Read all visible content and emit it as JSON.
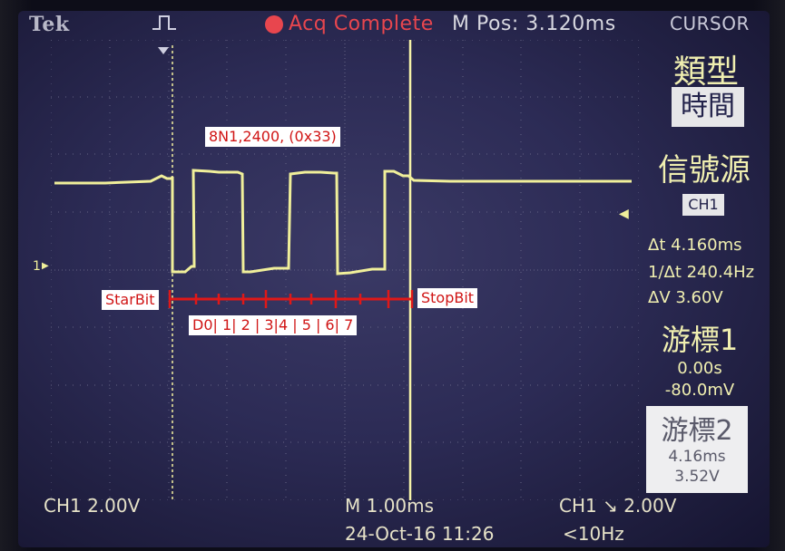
{
  "top": {
    "brand": "Tek",
    "status": "Acq Complete",
    "m_pos": "M Pos: 3.120ms",
    "menu_title": "CURSOR"
  },
  "panel": {
    "type_label": "類型",
    "type_value": "時間",
    "source_label": "信號源",
    "source_value": "CH1",
    "delta_t": "Δt 4.160ms",
    "inv_delta_t": "1/Δt 240.4Hz",
    "delta_v": "ΔV 3.60V",
    "cursor1_label": "游標1",
    "cursor1_time": "0.00s",
    "cursor1_volt": "-80.0mV",
    "cursor2_label": "游標2",
    "cursor2_time": "4.16ms",
    "cursor2_volt": "3.52V"
  },
  "bottom": {
    "ch1_scale": "CH1  2.00V",
    "timebase": "M 1.00ms",
    "trigger": "CH1 ↘ 2.00V",
    "datetime": "24-Oct-16 11:26",
    "freq": "<10Hz"
  },
  "channel_marker": "1",
  "annotations": {
    "frame": "8N1,2400, (0x33)",
    "start": "StarBit",
    "stop": "StopBit",
    "bits": "D0| 1| 2 | 3|4 | 5 | 6| 7"
  }
}
